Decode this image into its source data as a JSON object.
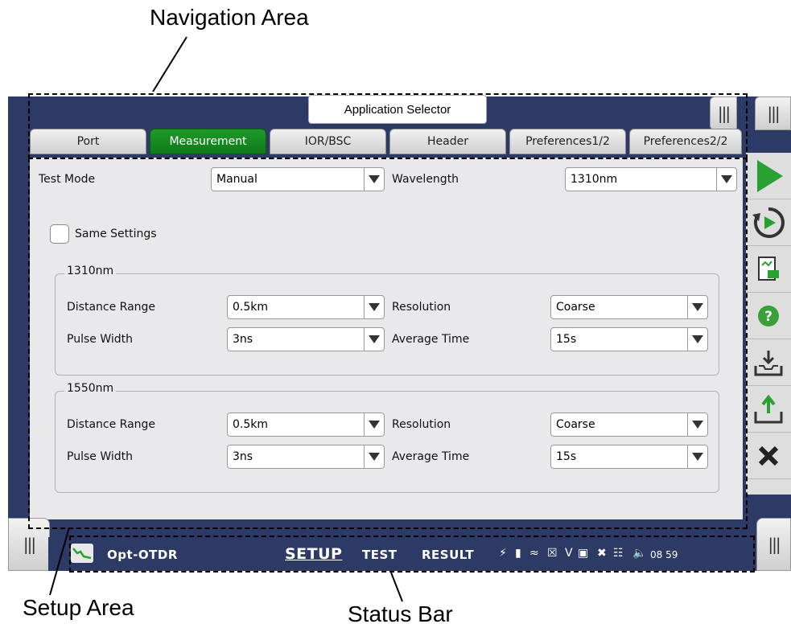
{
  "callouts": {
    "navigation_area": "Navigation Area",
    "setup_area": "Setup Area",
    "status_bar": "Status Bar"
  },
  "app_selector_label": "Application Selector",
  "tabs": [
    "Port",
    "Measurement",
    "IOR/BSC",
    "Header",
    "Preferences1/2",
    "Preferences2/2"
  ],
  "active_tab": "Measurement",
  "setup": {
    "test_mode_label": "Test Mode",
    "test_mode_value": "Manual",
    "wavelength_label": "Wavelength",
    "wavelength_value": "1310nm",
    "same_settings_label": "Same Settings",
    "groups": [
      {
        "title": "1310nm",
        "distance_range_label": "Distance Range",
        "distance_range_value": "0.5km",
        "resolution_label": "Resolution",
        "resolution_value": "Coarse",
        "pulse_width_label": "Pulse Width",
        "pulse_width_value": "3ns",
        "average_time_label": "Average Time",
        "average_time_value": "15s"
      },
      {
        "title": "1550nm",
        "distance_range_label": "Distance Range",
        "distance_range_value": "0.5km",
        "resolution_label": "Resolution",
        "resolution_value": "Coarse",
        "pulse_width_label": "Pulse Width",
        "pulse_width_value": "3ns",
        "average_time_label": "Average Time",
        "average_time_value": "15s"
      }
    ]
  },
  "status_bar": {
    "app_name": "Opt-OTDR",
    "modes": [
      "SETUP",
      "TEST",
      "RESULT"
    ],
    "active_mode": "SETUP",
    "time": "08 59"
  },
  "icons": [
    "menu-icon",
    "play-icon",
    "repeat-play-icon",
    "report-icon",
    "help-icon",
    "save-icon",
    "load-icon",
    "close-icon",
    "otdr-app-icon",
    "power-icon",
    "battery-icon",
    "wifi-icon",
    "bluetooth-icon",
    "vfl-icon",
    "terminal-icon",
    "satellite-icon",
    "network-icon",
    "volume-icon"
  ],
  "colors": {
    "frame": "#2e3a66",
    "active_tab": "#1a8f25",
    "play": "#2aa033",
    "help": "#3aa03a"
  }
}
